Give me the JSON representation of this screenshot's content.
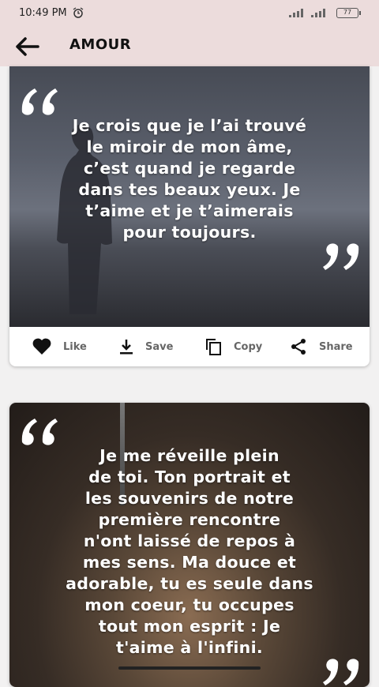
{
  "status_bar": {
    "time": "10:49 PM",
    "battery": "77"
  },
  "app_bar": {
    "title": "AMOUR"
  },
  "cards": [
    {
      "quote": "Je crois que je l’ai trouvé le miroir de mon âme, c’est quand je regarde dans tes beaux yeux. Je t’aime et je t’aimerais pour toujours.",
      "lines": [
        "Je crois que je l’ai trouvé",
        "le miroir de mon âme,",
        "c’est quand je regarde",
        "dans tes beaux yeux. Je",
        "t’aime et je t’aimerais",
        "pour toujours."
      ],
      "actions": {
        "like": "Like",
        "save": "Save",
        "copy": "Copy",
        "share": "Share"
      }
    },
    {
      "quote": "Je me réveille plein de toi. Ton portrait et les souvenirs de notre première rencontre n'ont laissé de repos à mes sens. Ma douce et adorable, tu es seule dans mon coeur, tu occupes tout mon esprit : Je t'aime à l'infini.",
      "lines": [
        "Je me réveille plein",
        "de toi. Ton portrait et",
        "les souvenirs de notre",
        "première rencontre",
        "n'ont laissé de repos à",
        "mes sens. Ma douce et",
        "adorable, tu es seule dans",
        "mon coeur, tu occupes",
        "tout mon esprit : Je",
        "t'aime à l'infini."
      ]
    }
  ]
}
